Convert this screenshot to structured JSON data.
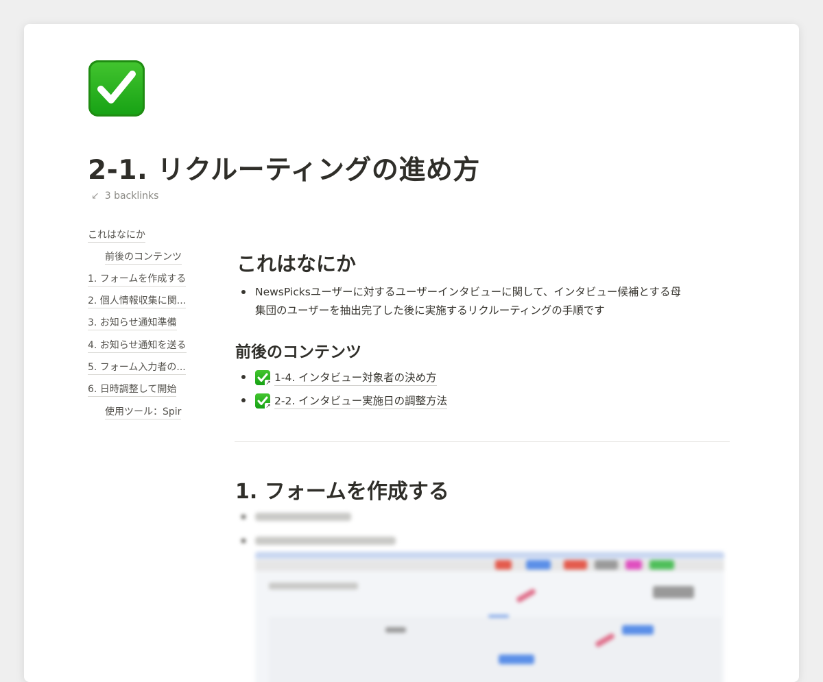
{
  "page": {
    "title": "2-1. リクルーティングの進め方",
    "backlinks": "3 backlinks",
    "icon": "white-check-mark-icon"
  },
  "toc": [
    {
      "label": "これはなにか"
    },
    {
      "label": "前後のコンテンツ"
    },
    {
      "label": "1. フォームを作成する"
    },
    {
      "label": "2. 個人情報収集に関..."
    },
    {
      "label": "3. お知らせ通知準備"
    },
    {
      "label": "4. お知らせ通知を送る"
    },
    {
      "label": "5. フォーム入力者の..."
    },
    {
      "label": "6. 日時調整して開始"
    },
    {
      "label": "使用ツール：Spir"
    }
  ],
  "sections": {
    "what": {
      "heading": "これはなにか",
      "text_line1": "NewsPicksユーザーに対するユーザーインタビューに関して、インタビュー候補とする母",
      "text_line2": "集団のユーザーを抽出完了した後に実施するリクルーティングの手順です"
    },
    "related": {
      "heading": "前後のコンテンツ",
      "links": [
        {
          "label": "1-4. インタビュー対象者の決め方"
        },
        {
          "label": "2-2. インタビュー実施日の調整方法"
        }
      ]
    },
    "form": {
      "heading": "1. フォームを作成する"
    }
  },
  "colors": {
    "background": "#efefef",
    "page": "#ffffff",
    "text": "#37352f",
    "check_green": "#16a114"
  }
}
